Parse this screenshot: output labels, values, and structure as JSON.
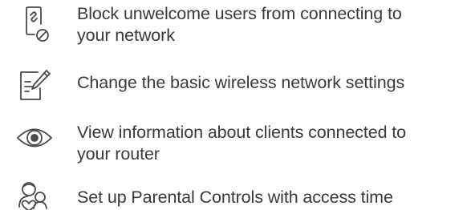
{
  "features": [
    {
      "icon": "device-block-icon",
      "lines": [
        "Block unwelcome users from connecting to",
        "your network"
      ]
    },
    {
      "icon": "edit-settings-icon",
      "lines": [
        "Change the basic wireless network settings"
      ]
    },
    {
      "icon": "eye-icon",
      "lines": [
        "View information about clients connected to",
        "your router"
      ]
    },
    {
      "icon": "parental-controls-icon",
      "lines": [
        "Set up Parental Controls with access time"
      ]
    }
  ],
  "colors": {
    "text": "#3a3a3a",
    "icon_stroke": "#4a4a4a",
    "background": "#ffffff"
  }
}
